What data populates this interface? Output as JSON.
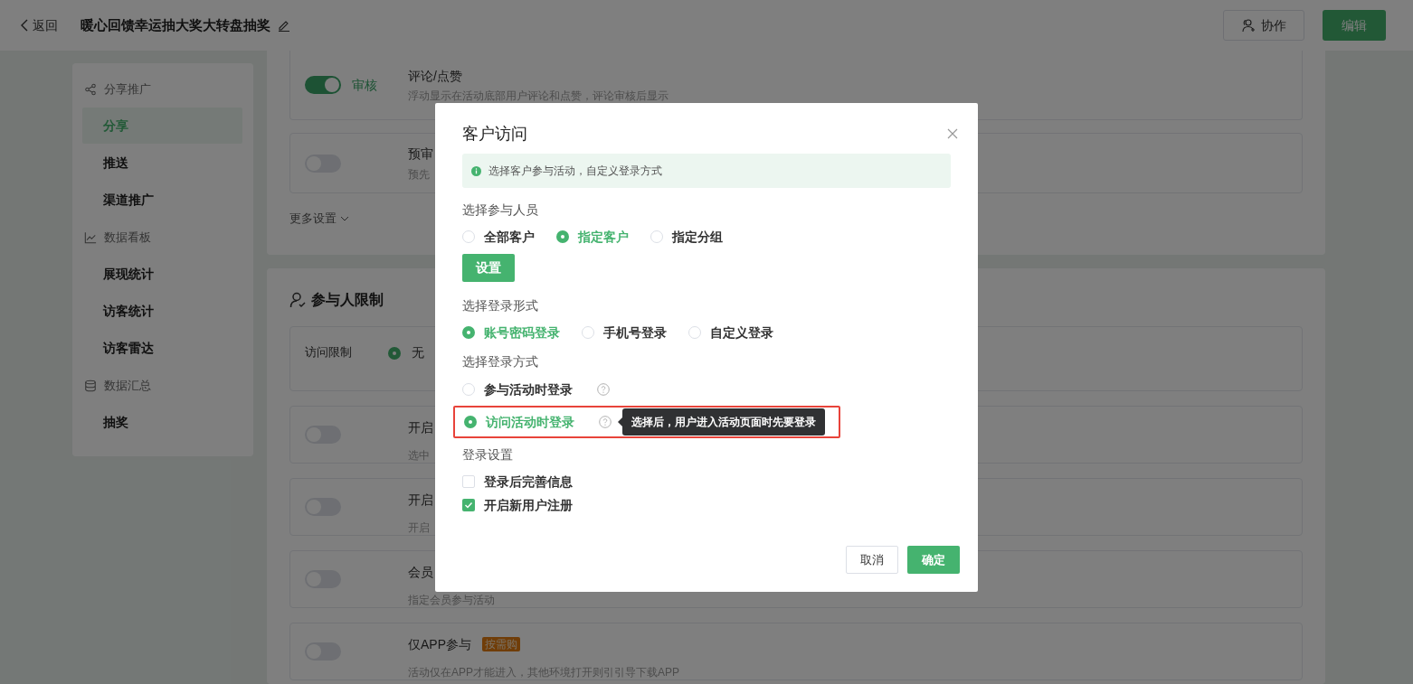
{
  "header": {
    "back": "返回",
    "title": "暖心回馈幸运抽大奖大转盘抽奖",
    "buttons": [
      {
        "label": "协作",
        "kind": "outline"
      },
      {
        "label": "编辑",
        "kind": "primary"
      }
    ]
  },
  "sidebar": {
    "groups": [
      {
        "title": "分享推广",
        "kind": "share",
        "items": [
          {
            "label": "分享",
            "selected": true
          },
          {
            "label": "推送",
            "selected": false
          },
          {
            "label": "渠道推广",
            "selected": false
          }
        ]
      },
      {
        "title": "数据看板",
        "kind": "chart",
        "items": [
          {
            "label": "展现统计",
            "selected": false
          },
          {
            "label": "访客统计",
            "selected": false
          },
          {
            "label": "访客雷达",
            "selected": false
          }
        ]
      },
      {
        "title": "数据汇总",
        "kind": "database",
        "items": [
          {
            "label": "抽奖",
            "selected": false
          }
        ]
      }
    ]
  },
  "settings_card": {
    "rows": [
      {
        "on": true,
        "status": "审核",
        "title": "评论/点赞",
        "description": "浮动显示在活动底部用户评论和点赞，评论审核后显示"
      },
      {
        "on": false,
        "title": "预审",
        "description": "预先"
      }
    ],
    "more": "更多设置"
  },
  "limits_card": {
    "title": "参与人限制",
    "access": {
      "label": "访问限制",
      "options": [
        {
          "label": "无",
          "selected": true
        }
      ]
    },
    "rows": [
      {
        "on": false,
        "title": "开启",
        "description": "选中"
      },
      {
        "on": false,
        "title": "开启",
        "description": "开启"
      },
      {
        "on": false,
        "title": "会员",
        "description": "指定会员参与活动"
      },
      {
        "on": false,
        "title": "仅APP参与",
        "badge": "按需购",
        "description": "活动仅在APP才能进入，其他环境打开则引引导下载APP"
      }
    ]
  },
  "dialog": {
    "title": "客户访问",
    "notice": "选择客户参与活动，自定义登录方式",
    "sections": [
      {
        "kind": "radio-row",
        "label": "选择参与人员",
        "options": [
          {
            "label": "全部客户",
            "selected": false
          },
          {
            "label": "指定客户",
            "selected": true
          },
          {
            "label": "指定分组",
            "selected": false
          }
        ],
        "button": "设置"
      },
      {
        "kind": "radio-row",
        "label": "选择登录形式",
        "options": [
          {
            "label": "账号密码登录",
            "selected": true
          },
          {
            "label": "手机号登录",
            "selected": false
          },
          {
            "label": "自定义登录",
            "selected": false
          }
        ]
      },
      {
        "kind": "radio-column",
        "label": "选择登录方式",
        "options": [
          {
            "label": "参与活动时登录",
            "selected": false,
            "highlighted": false
          },
          {
            "label": "访问活动时登录",
            "selected": true,
            "highlighted": true,
            "tooltip": "选择后，用户进入活动页面时先要登录"
          }
        ]
      },
      {
        "kind": "checkbox-column",
        "label": "登录设置",
        "options": [
          {
            "label": "登录后完善信息",
            "checked": false
          },
          {
            "label": "开启新用户注册",
            "checked": true
          }
        ]
      }
    ],
    "buttons": [
      {
        "label": "取消",
        "kind": "outline"
      },
      {
        "label": "确定",
        "kind": "primary"
      }
    ]
  }
}
